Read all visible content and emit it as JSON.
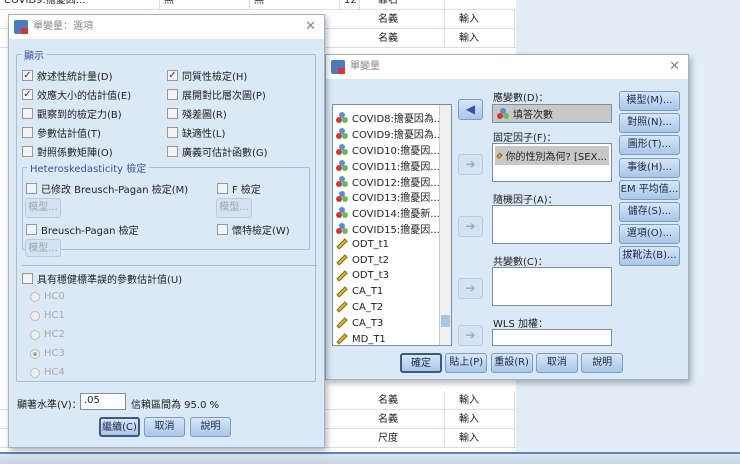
{
  "background": {
    "top_row": [
      "COVID9:擔憂因...",
      "無",
      "無",
      "12",
      "靠右"
    ],
    "rows": [
      {
        "measure": "名義",
        "role": "輸入"
      },
      {
        "measure": "名義",
        "role": "輸入"
      },
      {
        "measure": "名義",
        "role": "輸入"
      },
      {
        "measure": "名義",
        "role": "輸入"
      },
      {
        "measure": "名義",
        "role": "輸入"
      },
      {
        "measure": "尺度",
        "role": "輸入"
      }
    ]
  },
  "options_dialog": {
    "title": "單變量：選項",
    "display_legend": "顯示",
    "left_checks": [
      {
        "label": "敘述性統計量(D)",
        "checked": true
      },
      {
        "label": "效應大小的估計值(E)",
        "checked": true
      },
      {
        "label": "觀察到的檢定力(B)",
        "checked": false
      },
      {
        "label": "參數估計值(T)",
        "checked": false
      },
      {
        "label": "對照係數矩陣(O)",
        "checked": false
      }
    ],
    "right_checks": [
      {
        "label": "同質性檢定(H)",
        "checked": true
      },
      {
        "label": "展開對比層次圖(P)",
        "checked": false
      },
      {
        "label": "殘差圖(R)",
        "checked": false
      },
      {
        "label": "缺適性(L)",
        "checked": false
      },
      {
        "label": "廣義可估計函數(G)",
        "checked": false
      }
    ],
    "hetero_legend": "Heteroskedasticity 檢定",
    "modified_bp": "已修改 Breusch-Pagan 檢定(M)",
    "f_test": "F 檢定",
    "bp": "Breusch-Pagan 檢定",
    "white": "懷特檢定(W)",
    "model_button": "模型...",
    "robust": "具有穩健標準誤的參數估計值(U)",
    "hc": [
      {
        "label": "HC0",
        "selected": false
      },
      {
        "label": "HC1",
        "selected": false
      },
      {
        "label": "HC2",
        "selected": false
      },
      {
        "label": "HC3",
        "selected": true
      },
      {
        "label": "HC4",
        "selected": false
      }
    ],
    "sig_label": "顯著水準(V)：",
    "sig_value": ".05",
    "ci_text": "信賴區間為 95.0 %",
    "continue": "繼續(C)",
    "cancel": "取消",
    "help": "說明"
  },
  "main_dialog": {
    "title": "單變量",
    "variables": [
      {
        "name": "COVID8:擔憂因為...",
        "type": "nominal"
      },
      {
        "name": "COVID9:擔憂因為...",
        "type": "nominal"
      },
      {
        "name": "COVID10:擔憂因...",
        "type": "nominal"
      },
      {
        "name": "COVID11:擔憂因...",
        "type": "nominal"
      },
      {
        "name": "COVID12:擔憂因...",
        "type": "nominal"
      },
      {
        "name": "COVID13:擔憂因...",
        "type": "nominal"
      },
      {
        "name": "COVID14:擔憂新...",
        "type": "nominal"
      },
      {
        "name": "COVID15:擔憂因...",
        "type": "nominal"
      },
      {
        "name": "ODT_t1",
        "type": "scale"
      },
      {
        "name": "ODT_t2",
        "type": "scale"
      },
      {
        "name": "ODT_t3",
        "type": "scale"
      },
      {
        "name": "CA_T1",
        "type": "scale"
      },
      {
        "name": "CA_T2",
        "type": "scale"
      },
      {
        "name": "CA_T3",
        "type": "scale"
      },
      {
        "name": "MD_T1",
        "type": "scale"
      }
    ],
    "dependent_label": "應變數(D)：",
    "dependent_value": "填答次數",
    "fixed_label": "固定因子(F)：",
    "fixed_value": "你的性別為何? [SEX...",
    "random_label": "隨機因子(A)：",
    "covariate_label": "共變數(C)：",
    "wls_label": "WLS 加權：",
    "side_buttons": [
      "模型(M)...",
      "對照(N)...",
      "圖形(T)...",
      "事後(H)...",
      "EM 平均值...",
      "儲存(S)...",
      "選項(O)...",
      "拔靴法(B)..."
    ],
    "bottom_buttons": [
      "確定",
      "貼上(P)",
      "重設(R)",
      "取消",
      "說明"
    ]
  }
}
